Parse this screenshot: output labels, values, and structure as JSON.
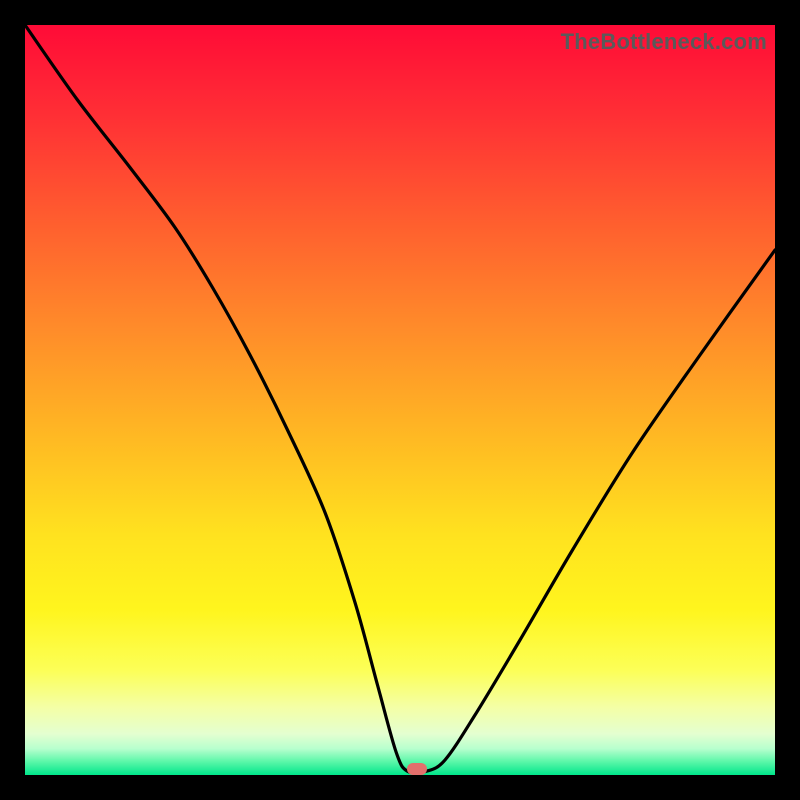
{
  "watermark": "TheBottleneck.com",
  "colors": {
    "black": "#000000",
    "curve": "#000000",
    "marker": "#e36f6c",
    "gradient_stops": [
      {
        "offset": 0.0,
        "color": "#ff0b37"
      },
      {
        "offset": 0.12,
        "color": "#ff2f35"
      },
      {
        "offset": 0.25,
        "color": "#ff5a2f"
      },
      {
        "offset": 0.4,
        "color": "#ff8a2a"
      },
      {
        "offset": 0.55,
        "color": "#ffb923"
      },
      {
        "offset": 0.68,
        "color": "#ffe21f"
      },
      {
        "offset": 0.78,
        "color": "#fff51e"
      },
      {
        "offset": 0.86,
        "color": "#fcff57"
      },
      {
        "offset": 0.91,
        "color": "#f4ffa6"
      },
      {
        "offset": 0.945,
        "color": "#e4ffd0"
      },
      {
        "offset": 0.965,
        "color": "#b7ffce"
      },
      {
        "offset": 0.982,
        "color": "#5cf7a9"
      },
      {
        "offset": 1.0,
        "color": "#00e68b"
      }
    ]
  },
  "chart_data": {
    "type": "line",
    "title": "",
    "xlabel": "",
    "ylabel": "",
    "xlim": [
      0,
      100
    ],
    "ylim": [
      0,
      100
    ],
    "grid": false,
    "legend": false,
    "series": [
      {
        "name": "bottleneck-curve",
        "x": [
          0,
          7,
          14,
          20,
          25,
          30,
          35,
          40,
          44,
          47,
          49.5,
          51,
          53.5,
          56,
          60,
          66,
          73,
          81,
          90,
          100
        ],
        "values": [
          100,
          90,
          81,
          73,
          65,
          56,
          46,
          35,
          23,
          12,
          3,
          0.5,
          0.5,
          2,
          8,
          18,
          30,
          43,
          56,
          70
        ]
      }
    ],
    "annotations": [
      {
        "name": "min-marker",
        "x": 52.3,
        "y": 0.8,
        "shape": "pill",
        "color": "#e36f6c"
      }
    ]
  }
}
